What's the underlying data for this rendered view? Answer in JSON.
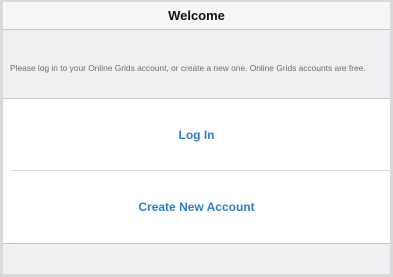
{
  "header": {
    "title": "Welcome"
  },
  "message": "Please log in to your Online Grids account, or create a new one. Online Grids accounts are free.",
  "actions": {
    "login_label": "Log In",
    "create_label": "Create New Account"
  },
  "colors": {
    "accent": "#2f7fc9",
    "background": "#efeff4",
    "outer_background": "#d6dbd8"
  }
}
